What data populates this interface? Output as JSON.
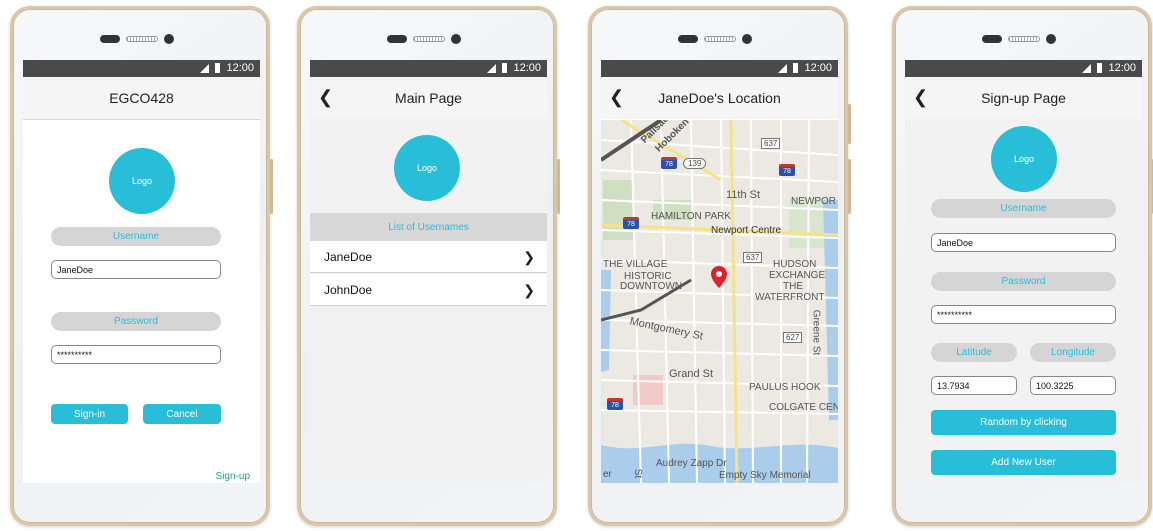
{
  "status_time": "12:00",
  "icons": {
    "back": "chevron-left-icon",
    "row_arrow": "chevron-right-icon",
    "map_pin": "map-pin-icon",
    "signal": "signal-icon",
    "battery": "battery-icon"
  },
  "colors": {
    "accent": "#29bed8",
    "pill_bg": "#d5d5d5",
    "link": "#1aa38e",
    "pin": "#e0202a",
    "statusbar": "#4a4a4a"
  },
  "signin": {
    "title": "EGCO428",
    "logo": "Logo",
    "username_label": "Username",
    "username_value": "JaneDoe",
    "password_label": "Password",
    "password_value": "**********",
    "signin_button": "Sign-in",
    "cancel_button": "Cancel",
    "signup_link": "Sign-up"
  },
  "main": {
    "title": "Main Page",
    "logo": "Logo",
    "list_header": "List of Usernames",
    "users": [
      "JaneDoe",
      "JohnDoe"
    ]
  },
  "location": {
    "title": "JaneDoe's Location",
    "map_labels": {
      "hoboken": "Hoboken",
      "palisade": "Palisade",
      "eleventh_st": "11th St",
      "hamilton_park": "HAMILTON PARK",
      "newport": "NEWPOR",
      "newport_centre": "Newport Centre",
      "the_village": "THE VILLAGE",
      "historic": "HISTORIC",
      "downtown": "DOWNTOWN",
      "hudson": "HUDSON",
      "exchange": "EXCHANGE",
      "the": "THE",
      "waterfront": "WATERFRONT",
      "montgomery": "Montgomery St",
      "greene": "Greene St",
      "grand": "Grand St",
      "paulus_hook": "PAULUS HOOK",
      "colgate": "COLGATE CEN",
      "audrey": "Audrey Zapp Dr",
      "empty_sky": "Empty Sky Memorial",
      "st": "St",
      "er": "er"
    },
    "route_labels": [
      "637",
      "139",
      "78",
      "78",
      "78",
      "637",
      "627",
      "78"
    ]
  },
  "signup": {
    "title": "Sign-up Page",
    "logo": "Logo",
    "username_label": "Username",
    "username_value": "JaneDoe",
    "password_label": "Password",
    "password_value": "**********",
    "latitude_label": "Latitude",
    "longitude_label": "Longitude",
    "latitude_value": "13.7934",
    "longitude_value": "100.3225",
    "random_button": "Random by clicking",
    "add_button": "Add New User"
  }
}
